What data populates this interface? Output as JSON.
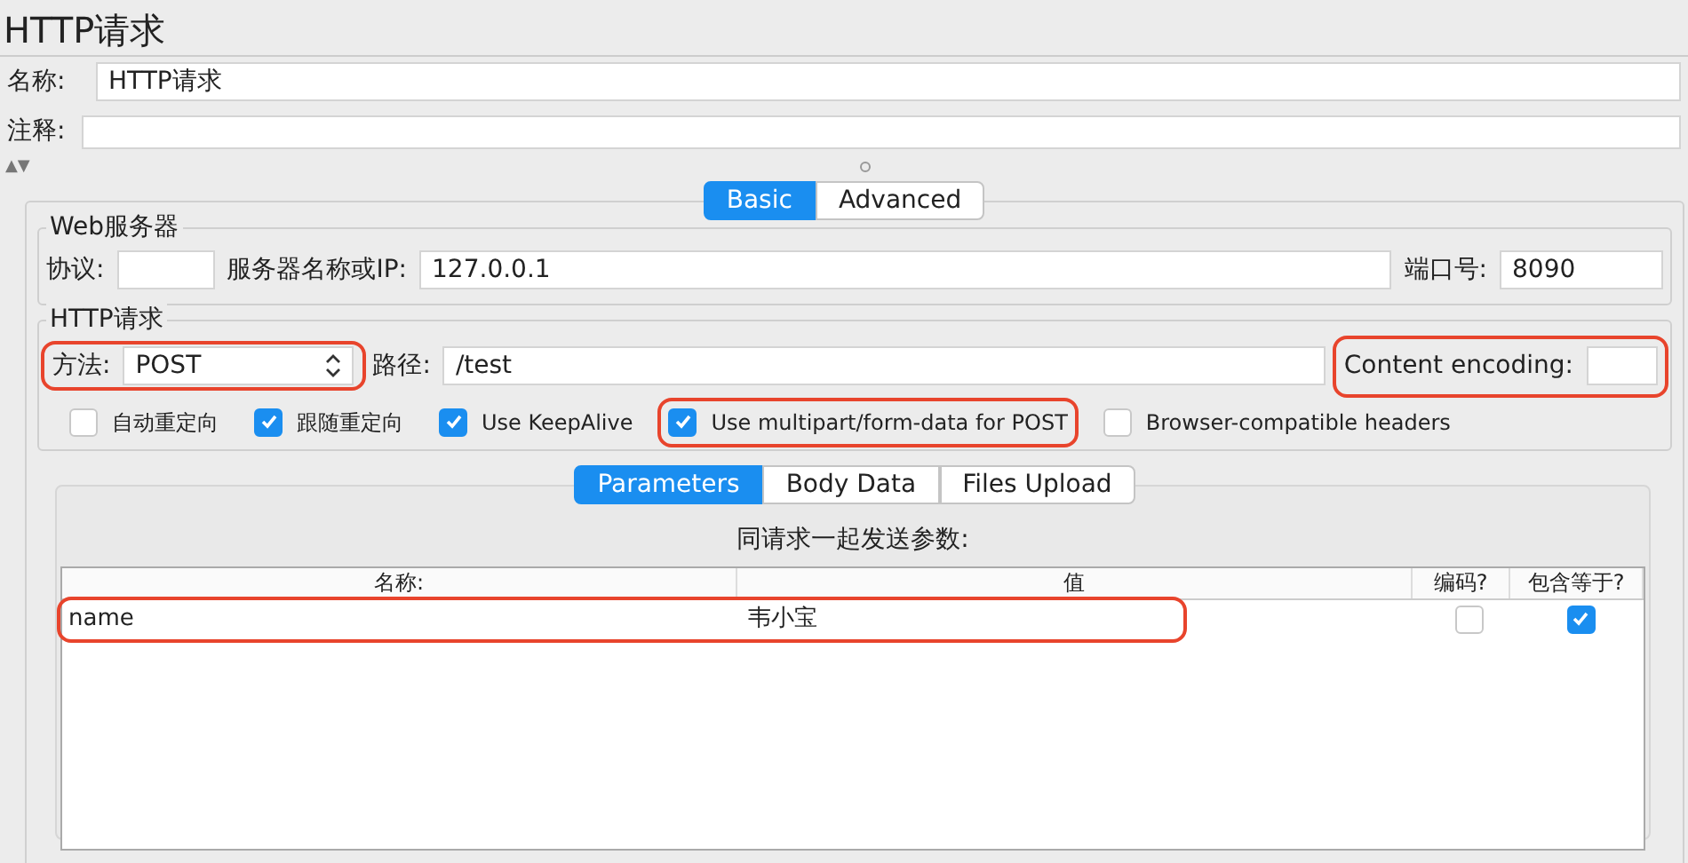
{
  "title": "HTTP请求",
  "name_field": {
    "label": "名称:",
    "value": "HTTP请求"
  },
  "comment_field": {
    "label": "注释:"
  },
  "collapse_arrows": "▲▼",
  "tabs": [
    {
      "label": "Basic",
      "selected": true
    },
    {
      "label": "Advanced",
      "selected": false
    }
  ],
  "web_server": {
    "legend": "Web服务器",
    "fields": [
      {
        "label": "协议:"
      },
      {
        "label": "服务器名称或IP:",
        "value": "127.0.0.1"
      },
      {
        "label": "端口号:",
        "value": "8090"
      }
    ]
  },
  "http_request": {
    "legend": "HTTP请求",
    "method": {
      "label": "方法:",
      "value": "POST",
      "highlighted": true
    },
    "path": {
      "label": "路径:",
      "value": "/test"
    },
    "content_encoding": {
      "label": "Content encoding:",
      "highlighted": true
    },
    "options": [
      {
        "label": "自动重定向",
        "checked": false,
        "highlighted": false
      },
      {
        "label": "跟随重定向",
        "checked": true,
        "highlighted": false
      },
      {
        "label": "Use KeepAlive",
        "checked": true,
        "highlighted": false
      },
      {
        "label": "Use multipart/form-data for POST",
        "checked": true,
        "highlighted": true
      },
      {
        "label": "Browser-compatible headers",
        "checked": false,
        "highlighted": false
      }
    ]
  },
  "sub_tabs": [
    {
      "label": "Parameters",
      "selected": true
    },
    {
      "label": "Body Data",
      "selected": false
    },
    {
      "label": "Files Upload",
      "selected": false
    }
  ],
  "parameters": {
    "caption": "同请求一起发送参数:",
    "columns": [
      "名称:",
      "值",
      "编码?",
      "包含等于?"
    ],
    "rows": [
      {
        "name": "name",
        "value": "韦小宝",
        "encode": false,
        "include_equals": true,
        "highlighted": true
      }
    ]
  }
}
